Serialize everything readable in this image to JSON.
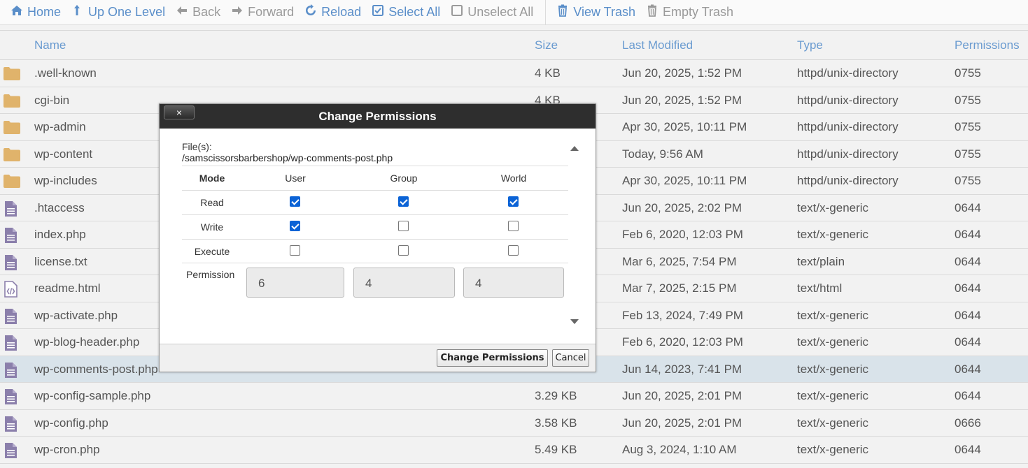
{
  "toolbar": {
    "home": "Home",
    "up": "Up One Level",
    "back": "Back",
    "forward": "Forward",
    "reload": "Reload",
    "select_all": "Select All",
    "unselect_all": "Unselect All",
    "view_trash": "View Trash",
    "empty_trash": "Empty Trash"
  },
  "columns": {
    "name": "Name",
    "size": "Size",
    "modified": "Last Modified",
    "type": "Type",
    "permissions": "Permissions"
  },
  "rows": [
    {
      "name": ".well-known",
      "size": "4 KB",
      "modified": "Jun 20, 2025, 1:52 PM",
      "type": "httpd/unix-directory",
      "perm": "0755",
      "icon": "folder-icon"
    },
    {
      "name": "cgi-bin",
      "size": "4 KB",
      "modified": "Jun 20, 2025, 1:52 PM",
      "type": "httpd/unix-directory",
      "perm": "0755",
      "icon": "folder-icon"
    },
    {
      "name": "wp-admin",
      "size": "",
      "modified": "Apr 30, 2025, 10:11 PM",
      "type": "httpd/unix-directory",
      "perm": "0755",
      "icon": "folder-icon"
    },
    {
      "name": "wp-content",
      "size": "",
      "modified": "Today, 9:56 AM",
      "type": "httpd/unix-directory",
      "perm": "0755",
      "icon": "folder-icon"
    },
    {
      "name": "wp-includes",
      "size": "",
      "modified": "Apr 30, 2025, 10:11 PM",
      "type": "httpd/unix-directory",
      "perm": "0755",
      "icon": "folder-icon"
    },
    {
      "name": ".htaccess",
      "size": "",
      "modified": "Jun 20, 2025, 2:02 PM",
      "type": "text/x-generic",
      "perm": "0644",
      "icon": "file-icon"
    },
    {
      "name": "index.php",
      "size": "",
      "modified": "Feb 6, 2020, 12:03 PM",
      "type": "text/x-generic",
      "perm": "0644",
      "icon": "file-icon"
    },
    {
      "name": "license.txt",
      "size": "",
      "modified": "Mar 6, 2025, 7:54 PM",
      "type": "text/plain",
      "perm": "0644",
      "icon": "file-icon"
    },
    {
      "name": "readme.html",
      "size": "",
      "modified": "Mar 7, 2025, 2:15 PM",
      "type": "text/html",
      "perm": "0644",
      "icon": "html-file-icon"
    },
    {
      "name": "wp-activate.php",
      "size": "",
      "modified": "Feb 13, 2024, 7:49 PM",
      "type": "text/x-generic",
      "perm": "0644",
      "icon": "file-icon"
    },
    {
      "name": "wp-blog-header.php",
      "size": "",
      "modified": "Feb 6, 2020, 12:03 PM",
      "type": "text/x-generic",
      "perm": "0644",
      "icon": "file-icon"
    },
    {
      "name": "wp-comments-post.php",
      "size": "",
      "modified": "Jun 14, 2023, 7:41 PM",
      "type": "text/x-generic",
      "perm": "0644",
      "icon": "file-icon",
      "selected": true
    },
    {
      "name": "wp-config-sample.php",
      "size": "3.29 KB",
      "modified": "Jun 20, 2025, 2:01 PM",
      "type": "text/x-generic",
      "perm": "0644",
      "icon": "file-icon"
    },
    {
      "name": "wp-config.php",
      "size": "3.58 KB",
      "modified": "Jun 20, 2025, 2:01 PM",
      "type": "text/x-generic",
      "perm": "0666",
      "icon": "file-icon"
    },
    {
      "name": "wp-cron.php",
      "size": "5.49 KB",
      "modified": "Aug 3, 2024, 1:10 AM",
      "type": "text/x-generic",
      "perm": "0644",
      "icon": "file-icon"
    }
  ],
  "dialog": {
    "title": "Change Permissions",
    "close_label": "×",
    "files_label": "File(s):",
    "files_path": "/samscissorsbarbershop/wp-comments-post.php",
    "mode_header": "Mode",
    "user_header": "User",
    "group_header": "Group",
    "world_header": "World",
    "read_label": "Read",
    "write_label": "Write",
    "execute_label": "Execute",
    "permission_label": "Permission",
    "user_value": "6",
    "group_value": "4",
    "world_value": "4",
    "checks": {
      "read": [
        true,
        true,
        true
      ],
      "write": [
        true,
        false,
        false
      ],
      "execute": [
        false,
        false,
        false
      ]
    },
    "submit_label": "Change Permissions",
    "cancel_label": "Cancel"
  }
}
